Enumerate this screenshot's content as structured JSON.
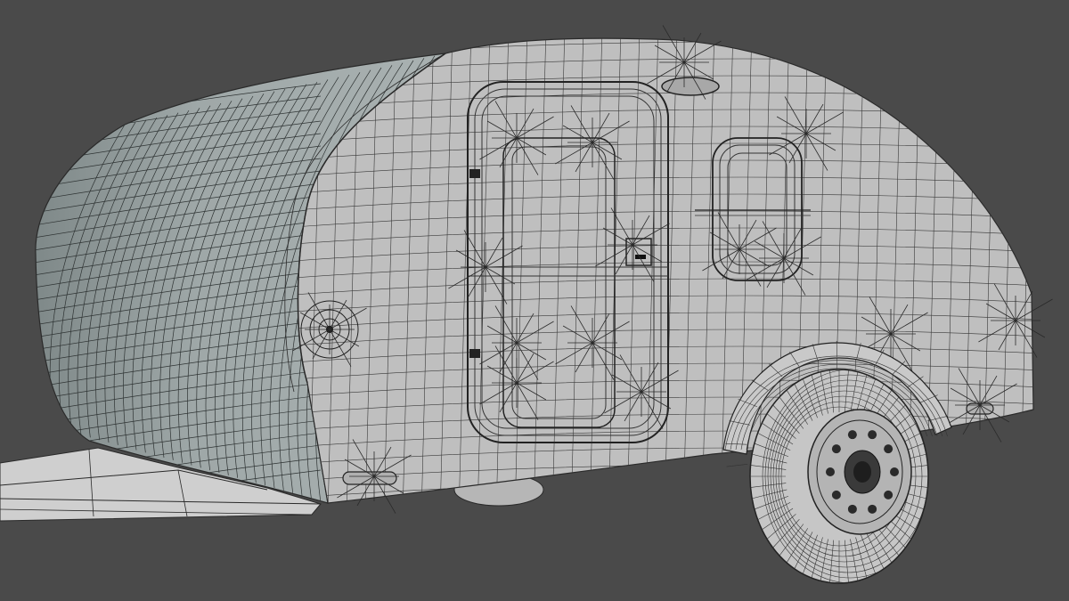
{
  "scene": {
    "subject": "teardrop-trailer-wireframe",
    "colors": {
      "background": "#4a4a4a",
      "body_fill": "#c2c2c2",
      "side_fill": "#bcbcbc",
      "shell_fill": "#9fa8a8",
      "shell_shadow": "#7f8989",
      "wire": "#2a2a2a",
      "wire_light": "#3a3a3a",
      "tire_fill": "#c6c6c6",
      "hub_fill": "#b4b4b4",
      "frame_fill": "#cfcfcf",
      "dark": "#1e1e1e"
    }
  }
}
